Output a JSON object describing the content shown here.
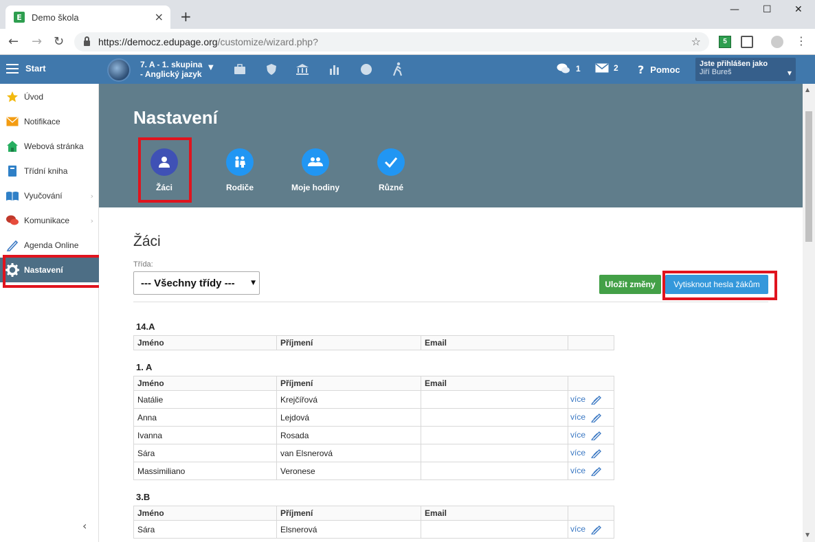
{
  "browser": {
    "tab_title": "Demo škola",
    "favicon_letter": "E",
    "url_host": "https://democz.edupage.org",
    "url_path": "/customize/wizard.php?",
    "ext_badge": "5"
  },
  "topbar": {
    "start_label": "Start",
    "class_line1": "7. A - 1. skupina",
    "class_line2": "- Anglický jazyk",
    "chat_count": "1",
    "mail_count": "2",
    "help_label": "Pomoc",
    "user_heading": "Jste přihlášen jako",
    "user_name": "Jiří Bureš"
  },
  "sidebar": {
    "items": [
      {
        "label": "Úvod",
        "icon": "star-icon"
      },
      {
        "label": "Notifikace",
        "icon": "envelope-icon"
      },
      {
        "label": "Webová stránka",
        "icon": "house-icon"
      },
      {
        "label": "Třídní kniha",
        "icon": "book-icon"
      },
      {
        "label": "Vyučování",
        "icon": "open-book-icon"
      },
      {
        "label": "Komunikace",
        "icon": "chat-icon"
      },
      {
        "label": "Agenda Online",
        "icon": "pen-icon"
      },
      {
        "label": "Nastavení",
        "icon": "gear-icon"
      }
    ]
  },
  "header": {
    "title": "Nastavení",
    "wizard": [
      {
        "label": "Žáci",
        "icon": "person-icon"
      },
      {
        "label": "Rodiče",
        "icon": "parents-icon"
      },
      {
        "label": "Moje hodiny",
        "icon": "group-icon"
      },
      {
        "label": "Různé",
        "icon": "check-icon"
      }
    ]
  },
  "main": {
    "section_title": "Žáci",
    "class_label": "Třída:",
    "class_value": "--- Všechny třídy ---",
    "save_label": "Uložit změny",
    "print_label": "Vytisknout hesla žákům",
    "col_first": "Jméno",
    "col_last": "Příjmení",
    "col_email": "Email",
    "more_label": "více",
    "groups": [
      {
        "name": "14.A",
        "rows": []
      },
      {
        "name": "1. A",
        "rows": [
          {
            "first": "Natálie",
            "last": "Krejčířová"
          },
          {
            "first": "Anna",
            "last": "Lejdová"
          },
          {
            "first": "Ivanna",
            "last": "Rosada"
          },
          {
            "first": "Sára",
            "last": "van Elsnerová"
          },
          {
            "first": "Massimiliano",
            "last": "Veronese"
          }
        ]
      },
      {
        "name": "3.B",
        "rows": [
          {
            "first": "Sára",
            "last": "Elsnerová"
          }
        ]
      }
    ]
  },
  "colors": {
    "topbar": "#4078ac",
    "header_bg": "#607d8b",
    "highlight": "#e0141e",
    "save_btn": "#43a047",
    "print_btn": "#3498db"
  }
}
